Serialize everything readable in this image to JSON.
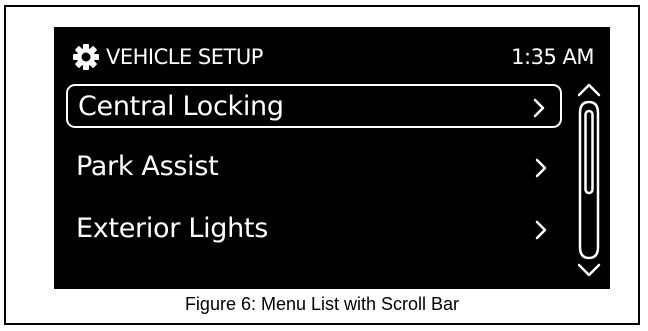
{
  "header": {
    "icon": "gear-icon",
    "title": "VEHICLE SETUP",
    "time": "1:35 AM"
  },
  "menu": {
    "items": [
      {
        "label": "Central Locking",
        "selected": true,
        "chevron": "chevron-right-icon"
      },
      {
        "label": "Park Assist",
        "selected": false,
        "chevron": "chevron-right-icon"
      },
      {
        "label": "Exterior Lights",
        "selected": false,
        "chevron": "chevron-right-icon"
      }
    ]
  },
  "scrollbar": {
    "up_icon": "chevron-up-icon",
    "down_icon": "chevron-down-icon"
  },
  "caption": "Figure 6: Menu List with Scroll Bar",
  "colors": {
    "screen_background": "#000000",
    "foreground": "#ffffff",
    "page_background": "#ffffff",
    "caption_text": "#000000"
  }
}
